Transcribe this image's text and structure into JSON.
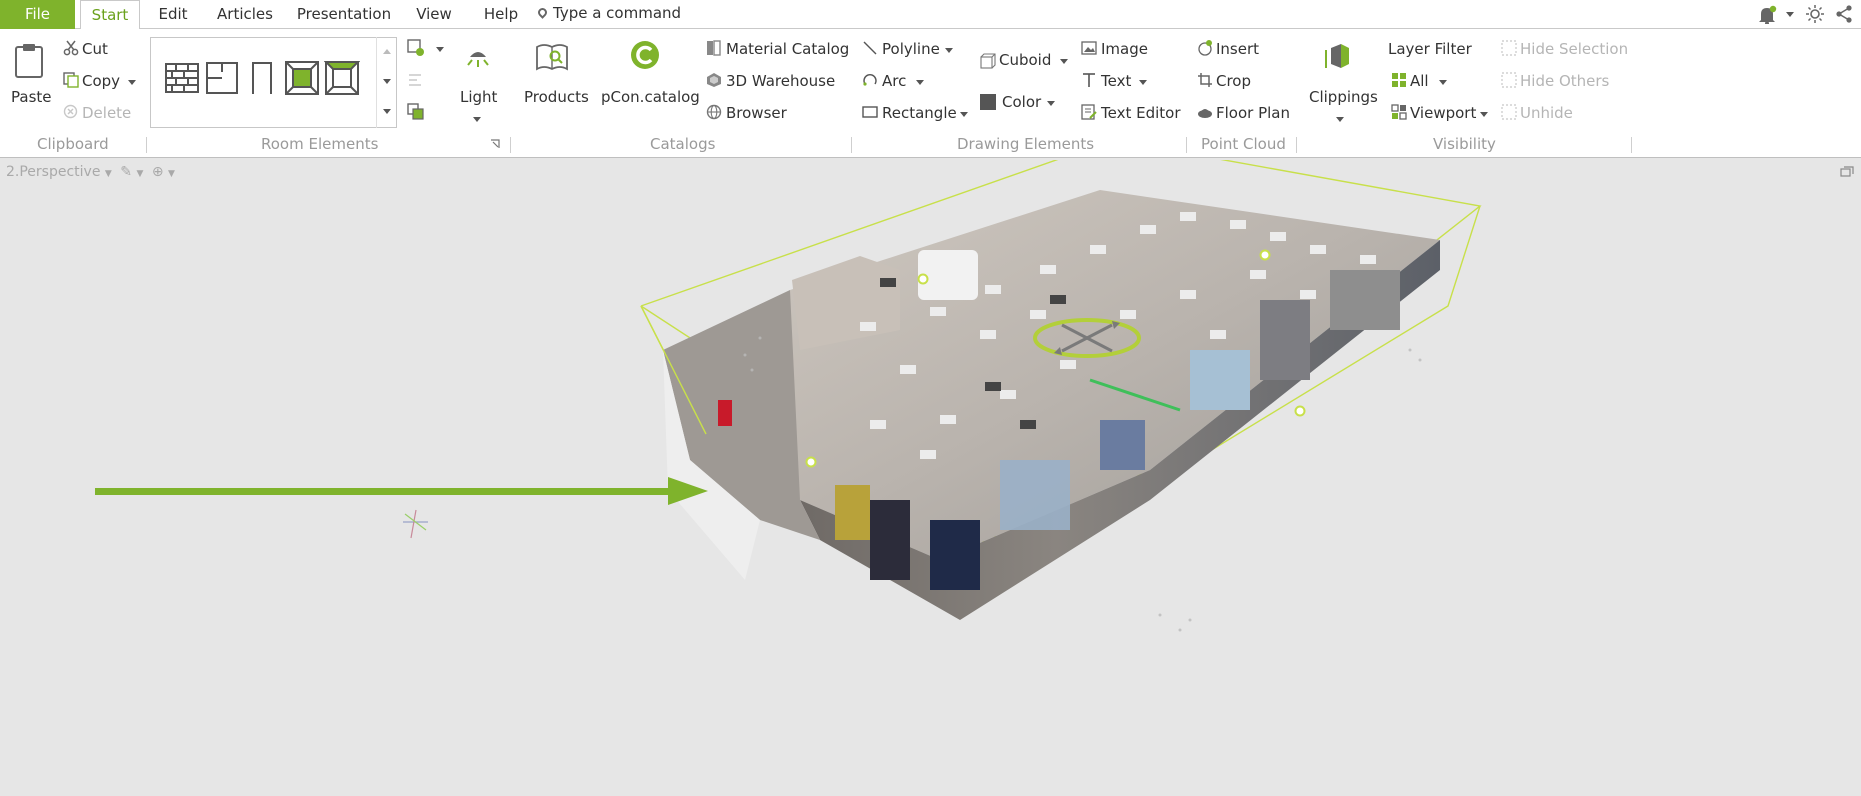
{
  "tabs": {
    "file": "File",
    "start": "Start",
    "edit": "Edit",
    "articles": "Articles",
    "presentation": "Presentation",
    "view": "View",
    "help": "Help"
  },
  "command_search": {
    "placeholder": "Type a command"
  },
  "clipboard": {
    "paste": "Paste",
    "cut": "Cut",
    "copy": "Copy",
    "delete": "Delete",
    "group": "Clipboard"
  },
  "room_elements": {
    "group": "Room Elements"
  },
  "light": {
    "label": "Light"
  },
  "products": {
    "label": "Products"
  },
  "pcon_catalog": {
    "label": "pCon.catalog"
  },
  "catalogs": {
    "material_catalog": "Material Catalog",
    "warehouse": "3D Warehouse",
    "browser": "Browser",
    "group": "Catalogs"
  },
  "drawing": {
    "polyline": "Polyline",
    "arc": "Arc",
    "rectangle": "Rectangle",
    "cuboid": "Cuboid",
    "color": "Color",
    "image": "Image",
    "text": "Text",
    "text_editor": "Text Editor",
    "group": "Drawing Elements"
  },
  "point_cloud": {
    "insert": "Insert",
    "crop": "Crop",
    "floor_plan": "Floor Plan",
    "group": "Point Cloud"
  },
  "visibility": {
    "clippings": "Clippings",
    "layer_filter": "Layer Filter",
    "all": "All",
    "viewport": "Viewport",
    "hide_selection": "Hide Selection",
    "hide_others": "Hide Others",
    "unhide": "Unhide",
    "group": "Visibility"
  },
  "viewport_panel": {
    "title": "2.Perspective"
  },
  "colors": {
    "accent": "#7fb32c",
    "bbox": "#c8e04a",
    "background": "#e6e6e6"
  },
  "icons": [
    "bell-icon",
    "sun-icon",
    "share-icon",
    "paste-icon",
    "scissors-icon",
    "copy-icon",
    "delete-icon",
    "wall-icon",
    "light-icon",
    "products-icon",
    "pcon-catalog-icon",
    "arrow-icon",
    "move-gizmo-icon"
  ]
}
